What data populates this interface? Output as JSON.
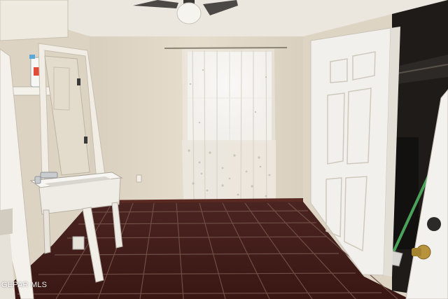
{
  "photo": {
    "subject": "laundry-room",
    "colors": {
      "wall": "#e4dccd",
      "ceiling": "#e9e5dc",
      "floor_tile": "#4a1f1a",
      "grout": "#6b4f48",
      "door": "#f2f0ec",
      "curtain": "#ede9e3",
      "window_light": "#ffffff"
    }
  },
  "watermark": {
    "text": "GEPAR MLS"
  }
}
